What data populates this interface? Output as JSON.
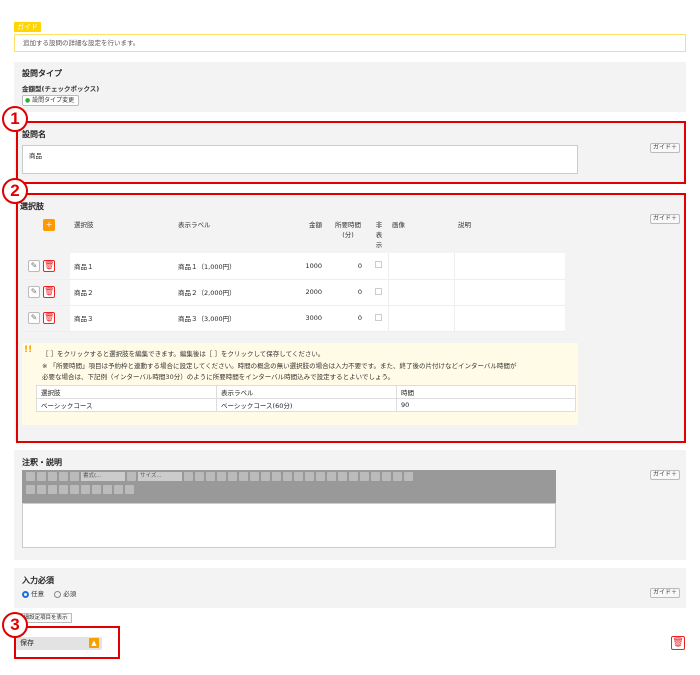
{
  "guide": {
    "tag": "ガイド",
    "text": "追加する設問の詳細な設定を行います。"
  },
  "question_type": {
    "title": "設問タイプ",
    "value": "金額型(チェックボックス)",
    "change_button": "設問タイプ変更"
  },
  "question_name": {
    "title": "設問名",
    "value": "商品",
    "guide_button": "ガイド＋"
  },
  "options": {
    "title": "選択肢",
    "guide_button": "ガイド＋",
    "headers": [
      "選択肢",
      "表示ラベル",
      "金額",
      "所要時間\n(分)",
      "非\n表\n示",
      "画像",
      "説明"
    ],
    "rows": [
      {
        "choice": "商品１",
        "label": "商品１（1,000円）",
        "amount": "1000",
        "minutes": "0"
      },
      {
        "choice": "商品２",
        "label": "商品２（2,000円）",
        "amount": "2000",
        "minutes": "0"
      },
      {
        "choice": "商品３",
        "label": "商品３（3,000円）",
        "amount": "3000",
        "minutes": "0"
      }
    ],
    "note1": "［ ］をクリックすると選択肢を編集できます。編集後は［ ］をクリックして保存してください。",
    "note2": "※ 「所要時間」項目は予約枠と連動する場合に設定してください。時間の概念の無い選択肢の場合は入力不要です。また、終了後の片付けなどインターバル時間が",
    "note3": "必要な場合は、下記例（インターバル時間30分）のように所要時間をインターバル時間込みで設定するとよいでしょう。",
    "example_headers": [
      "選択肢",
      "表示ラベル",
      "時間"
    ],
    "example_row": [
      "ベーシックコース",
      "ベーシックコース(60分)",
      "90"
    ]
  },
  "annotation": {
    "title": "注釈・説明",
    "guide_button": "ガイド＋",
    "font_select": "書式(...",
    "size_select": "サイズ..."
  },
  "required": {
    "title": "入力必須",
    "option_any": "任意",
    "option_required": "必須",
    "guide_button": "ガイド＋"
  },
  "detail_link": "詳細設定項目を表示",
  "save_button": "保存",
  "markers": [
    "1",
    "2",
    "3"
  ]
}
